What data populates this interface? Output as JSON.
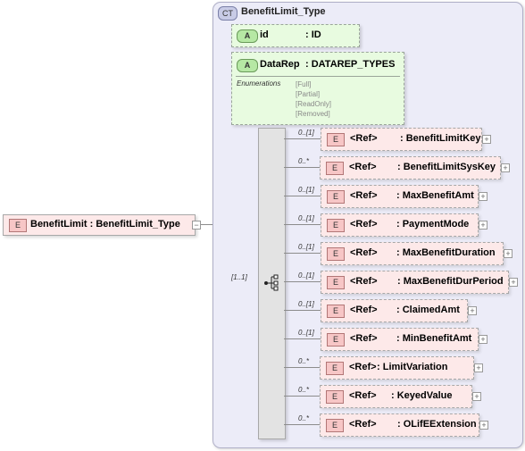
{
  "complex_type": {
    "badge": "CT",
    "title": "BenefitLimit_Type"
  },
  "root": {
    "badge": "E",
    "label": "BenefitLimit : BenefitLimit_Type"
  },
  "attributes": [
    {
      "badge": "A",
      "name": "id",
      "type": ": ID"
    },
    {
      "badge": "A",
      "name": "DataRep",
      "type": ": DATAREP_TYPES",
      "enum_label": "Enumerations",
      "enum_values": [
        "[Full]",
        "[Partial]",
        "[ReadOnly]",
        "[Removed]"
      ]
    }
  ],
  "sequence": {
    "cardinality": "[1..1]"
  },
  "elements": [
    {
      "card": "0..[1]",
      "badge": "E",
      "ref": "<Ref>",
      "name": ": BenefitLimitKey"
    },
    {
      "card": "0..*",
      "badge": "E",
      "ref": "<Ref>",
      "name": ": BenefitLimitSysKey"
    },
    {
      "card": "0..[1]",
      "badge": "E",
      "ref": "<Ref>",
      "name": ": MaxBenefitAmt"
    },
    {
      "card": "0..[1]",
      "badge": "E",
      "ref": "<Ref>",
      "name": ": PaymentMode"
    },
    {
      "card": "0..[1]",
      "badge": "E",
      "ref": "<Ref>",
      "name": ": MaxBenefitDuration"
    },
    {
      "card": "0..[1]",
      "badge": "E",
      "ref": "<Ref>",
      "name": ": MaxBenefitDurPeriod"
    },
    {
      "card": "0..[1]",
      "badge": "E",
      "ref": "<Ref>",
      "name": ": ClaimedAmt"
    },
    {
      "card": "0..[1]",
      "badge": "E",
      "ref": "<Ref>",
      "name": ": MinBenefitAmt"
    },
    {
      "card": "0..*",
      "badge": "E",
      "ref": "<Ref>",
      "name": ": LimitVariation"
    },
    {
      "card": "0..*",
      "badge": "E",
      "ref": "<Ref>",
      "name": ": KeyedValue"
    },
    {
      "card": "0..*",
      "badge": "E",
      "ref": "<Ref>",
      "name": ": OLifEExtension"
    }
  ]
}
